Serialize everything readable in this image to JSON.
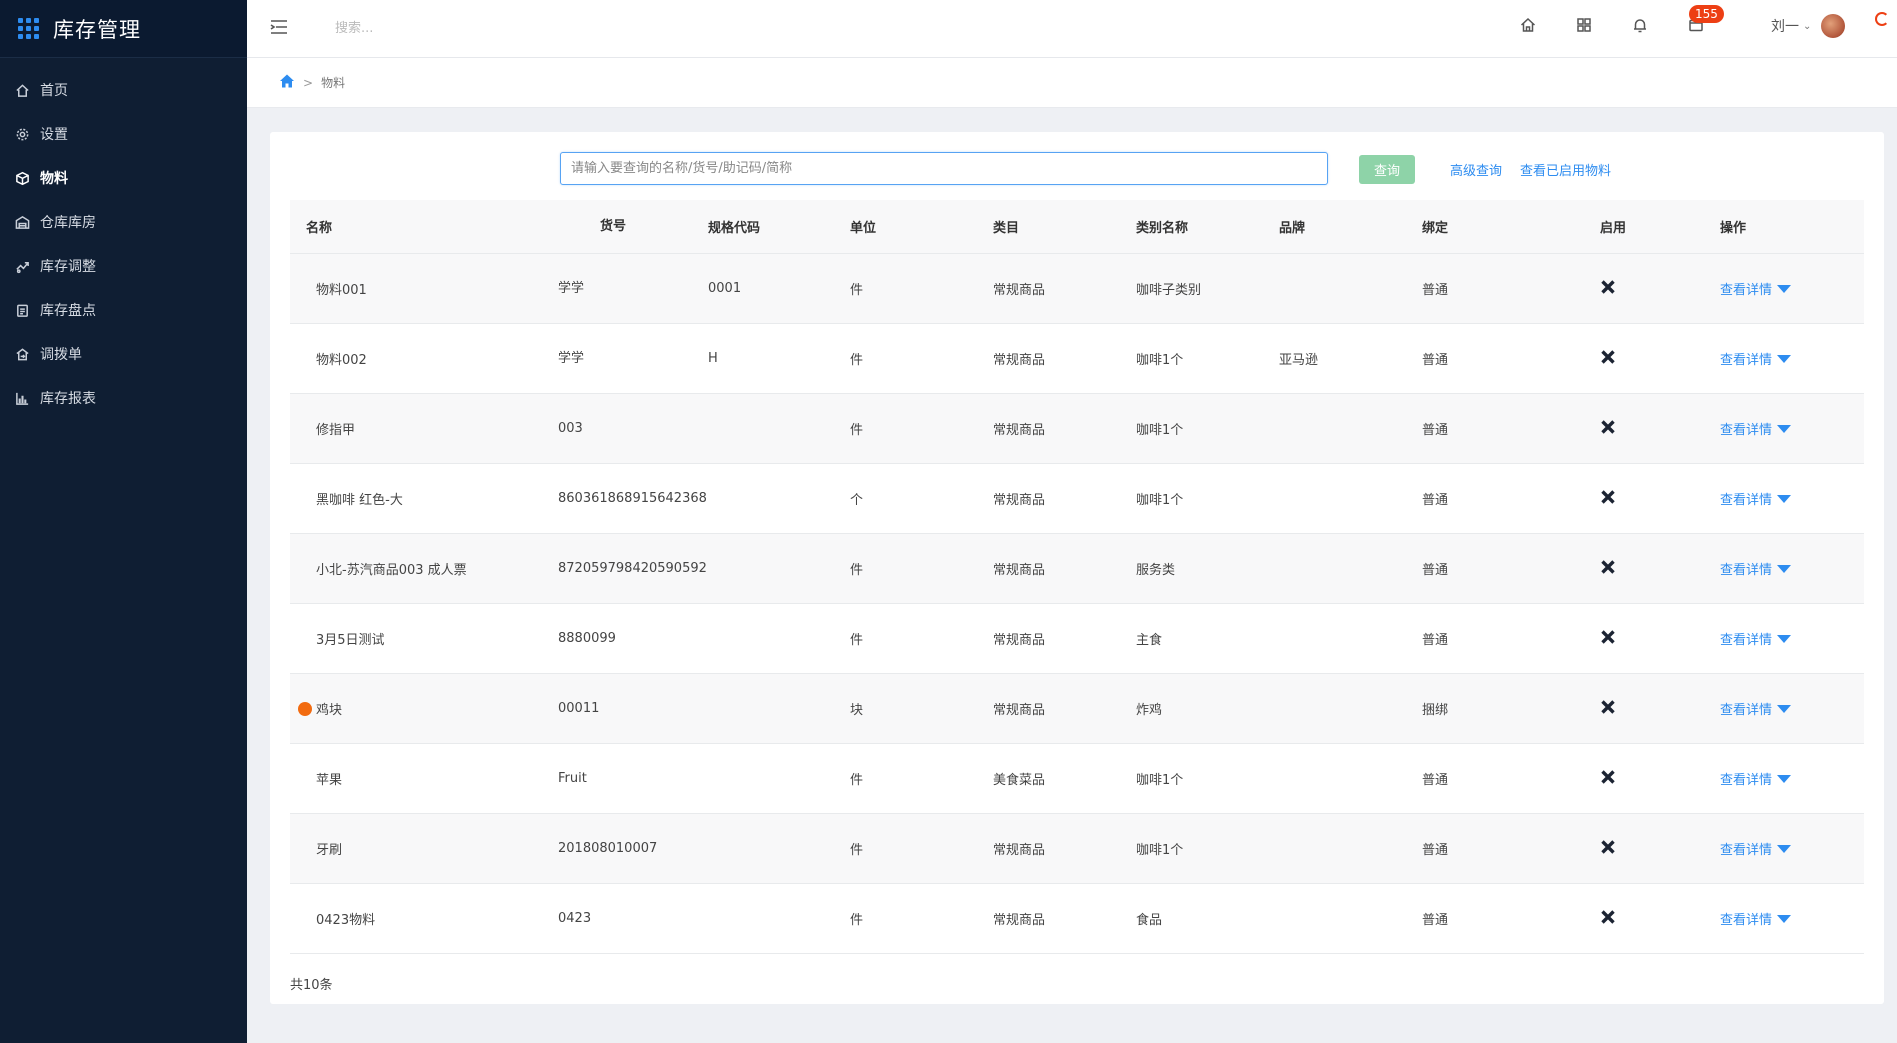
{
  "app": {
    "title": "库存管理"
  },
  "sidebar": {
    "items": [
      {
        "label": "首页",
        "icon": "home-icon"
      },
      {
        "label": "设置",
        "icon": "gear-icon"
      },
      {
        "label": "物料",
        "icon": "box-icon",
        "active": true
      },
      {
        "label": "仓库库房",
        "icon": "warehouse-icon"
      },
      {
        "label": "库存调整",
        "icon": "adjust-icon"
      },
      {
        "label": "库存盘点",
        "icon": "clipboard-icon"
      },
      {
        "label": "调拨单",
        "icon": "transfer-icon"
      },
      {
        "label": "库存报表",
        "icon": "bar-chart-icon"
      }
    ]
  },
  "header": {
    "search_placeholder": "搜索...",
    "message_count": "155",
    "user_name": "刘一"
  },
  "breadcrumb": {
    "current": "物料",
    "separator": ">"
  },
  "toolbar": {
    "search_placeholder": "请输入要查询的名称/货号/助记码/简称",
    "query_label": "查询",
    "advanced_label": "高级查询",
    "enabled_label": "查看已启用物料"
  },
  "table": {
    "columns": [
      "名称",
      "货号",
      "规格代码",
      "单位",
      "类目",
      "类别名称",
      "品牌",
      "绑定",
      "启用",
      "操作"
    ],
    "op_label": "查看详情",
    "rows": [
      {
        "name": "物料001",
        "code": "学学",
        "spec": "0001",
        "unit": "件",
        "category": "常规商品",
        "category_name": "咖啡子类别",
        "brand": "",
        "bind": "普通",
        "enabled": false,
        "marked": false
      },
      {
        "name": "物料002",
        "code": "学学",
        "spec": "H",
        "unit": "件",
        "category": "常规商品",
        "category_name": "咖啡1个",
        "brand": "亚马逊",
        "bind": "普通",
        "enabled": false,
        "marked": false
      },
      {
        "name": "修指甲",
        "code": "003",
        "spec": "",
        "unit": "件",
        "category": "常规商品",
        "category_name": "咖啡1个",
        "brand": "",
        "bind": "普通",
        "enabled": false,
        "marked": false
      },
      {
        "name": "黑咖啡 红色-大",
        "code": "860361868915642368",
        "spec": "",
        "unit": "个",
        "category": "常规商品",
        "category_name": "咖啡1个",
        "brand": "",
        "bind": "普通",
        "enabled": false,
        "marked": false
      },
      {
        "name": "小北-苏汽商品003 成人票",
        "code": "872059798420590592",
        "spec": "",
        "unit": "件",
        "category": "常规商品",
        "category_name": "服务类",
        "brand": "",
        "bind": "普通",
        "enabled": false,
        "marked": false
      },
      {
        "name": "3月5日测试",
        "code": "8880099",
        "spec": "",
        "unit": "件",
        "category": "常规商品",
        "category_name": "主食",
        "brand": "",
        "bind": "普通",
        "enabled": false,
        "marked": false
      },
      {
        "name": "鸡块",
        "code": "00011",
        "spec": "",
        "unit": "块",
        "category": "常规商品",
        "category_name": "炸鸡",
        "brand": "",
        "bind": "捆绑",
        "enabled": false,
        "marked": true
      },
      {
        "name": "苹果",
        "code": "Fruit",
        "spec": "",
        "unit": "件",
        "category": "美食菜品",
        "category_name": "咖啡1个",
        "brand": "",
        "bind": "普通",
        "enabled": false,
        "marked": false
      },
      {
        "name": "牙刷",
        "code": "201808010007",
        "spec": "",
        "unit": "件",
        "category": "常规商品",
        "category_name": "咖啡1个",
        "brand": "",
        "bind": "普通",
        "enabled": false,
        "marked": false
      },
      {
        "name": "0423物料",
        "code": "0423",
        "spec": "",
        "unit": "件",
        "category": "常规商品",
        "category_name": "食品",
        "brand": "",
        "bind": "普通",
        "enabled": false,
        "marked": false
      }
    ]
  },
  "footer": {
    "total_label": "共10条"
  },
  "colors": {
    "sidebar_bg": "#0f1e33",
    "accent": "#2d8cf0",
    "query_button": "#8ed3a8",
    "badge": "#ed3f14",
    "marker": "#f26b10"
  }
}
